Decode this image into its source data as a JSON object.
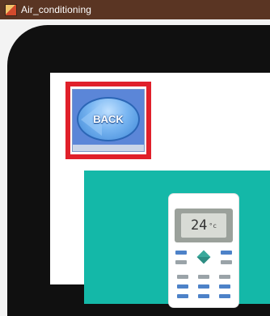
{
  "window": {
    "title": "Air_conditioning",
    "app_icon": "app-icon"
  },
  "back_button": {
    "label": "BACK",
    "icon": "back-arrow-icon"
  },
  "remote": {
    "temperature": "24",
    "unit": "°c"
  },
  "colors": {
    "titlebar": "#5a3523",
    "highlight": "#e0202a",
    "teal": "#14b8a8",
    "button_blue": "#5b86d8"
  }
}
